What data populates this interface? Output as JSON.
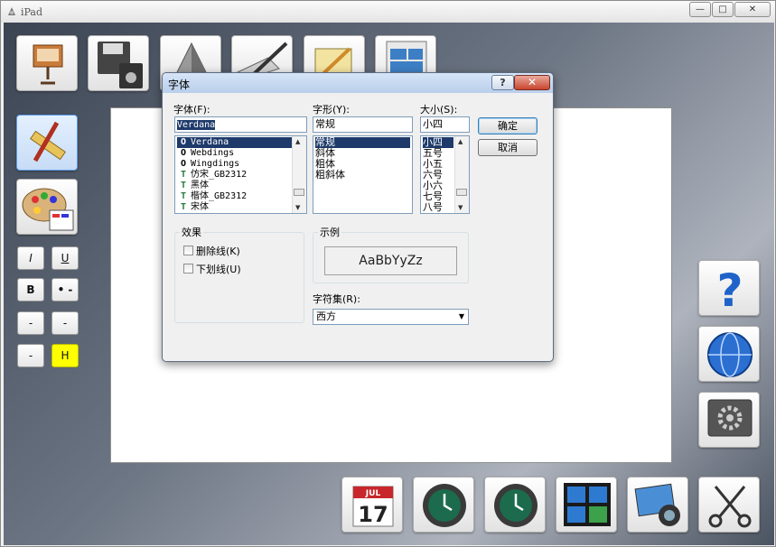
{
  "window": {
    "title": "iPad",
    "controls": [
      "—",
      "□",
      "✕"
    ]
  },
  "toolbar": {
    "top_tiles": [
      "keynote-icon",
      "save-disk-icon",
      "pyramid-icon",
      "pen-icon",
      "ruler-icon",
      "layout-icon"
    ],
    "bottom_tiles": [
      "calendar-icon",
      "time-machine-icon",
      "time-machine-icon",
      "dashboard-icon",
      "photo-icon",
      "scissors-icon"
    ],
    "calendar": {
      "month": "JUL",
      "day": "17"
    },
    "right_tiles": [
      "help-icon",
      "globe-icon",
      "settings-icon"
    ],
    "help_glyph": "?"
  },
  "format_buttons": {
    "italic": "I",
    "underline": "U",
    "bold": "B",
    "bullet": "• -",
    "dash_a": "-",
    "dash_b": "-",
    "dash_c": "-",
    "highlight": "H"
  },
  "font_dialog": {
    "title": "字体",
    "help": "?",
    "close": "✕",
    "font_label": "字体(F):",
    "font_value": "Verdana",
    "font_list": [
      "Verdana",
      "Webdings",
      "Wingdings",
      "仿宋_GB2312",
      "黑体",
      "楷体_GB2312",
      "宋体"
    ],
    "style_label": "字形(Y):",
    "style_value": "常规",
    "style_list": [
      "常规",
      "斜体",
      "粗体",
      "粗斜体"
    ],
    "size_label": "大小(S):",
    "size_value": "小四",
    "size_list": [
      "小四",
      "五号",
      "小五",
      "六号",
      "小六",
      "七号",
      "八号"
    ],
    "ok_label": "确定",
    "cancel_label": "取消",
    "effects_label": "效果",
    "strikeout_label": "删除线(K)",
    "underline_label": "下划线(U)",
    "sample_label": "示例",
    "sample_text": "AaBbYyZz",
    "charset_label": "字符集(R):",
    "charset_value": "西方"
  },
  "colors": {
    "accent": "#1e3a6a",
    "highlight": "#ffff00",
    "close_red": "#c9452f"
  }
}
